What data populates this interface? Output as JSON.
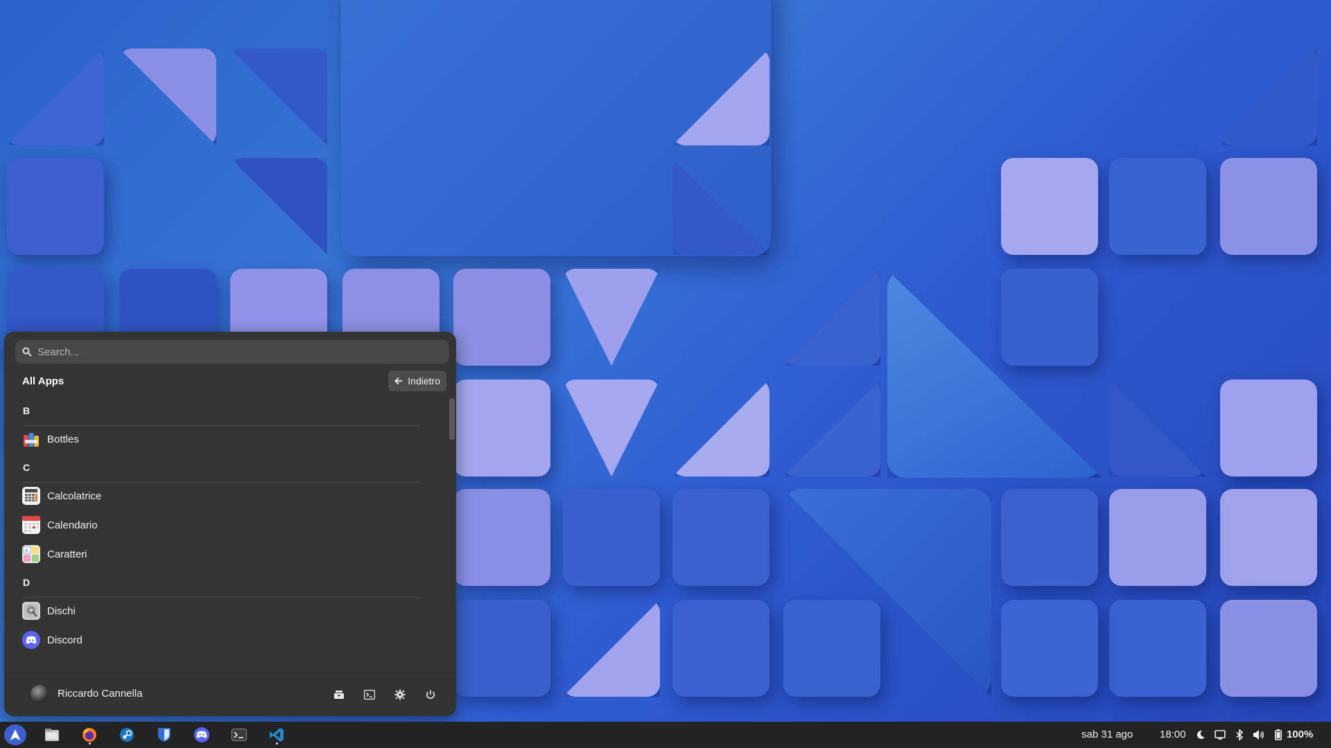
{
  "menu": {
    "search": {
      "placeholder": "Search..."
    },
    "title": "All Apps",
    "back_label": "Indietro",
    "sections": [
      {
        "letter": "B",
        "apps": [
          "Bottles"
        ]
      },
      {
        "letter": "C",
        "apps": [
          "Calcolatrice",
          "Calendario",
          "Caratteri"
        ]
      },
      {
        "letter": "D",
        "apps": [
          "Dischi",
          "Discord"
        ]
      }
    ],
    "user_name": "Riccardo Cannella",
    "footer_icons": [
      "files-drawer-icon",
      "terminal-icon",
      "settings-gear-icon",
      "power-icon"
    ]
  },
  "taskbar": {
    "pinned": [
      "arch-launcher-icon",
      "files-icon",
      "firefox-icon",
      "steam-icon",
      "bitwarden-icon",
      "discord-icon",
      "terminal-icon",
      "vscode-icon"
    ],
    "date": "sab 31 ago",
    "time": "18:00",
    "tray": [
      "night-mode-icon",
      "screen-icon",
      "bluetooth-icon",
      "volume-icon",
      "battery-icon"
    ],
    "battery": "100%"
  },
  "colors": {
    "panel": "#353535",
    "taskbar": "#232323",
    "wallpaper_blue": "#2f5bd0"
  }
}
